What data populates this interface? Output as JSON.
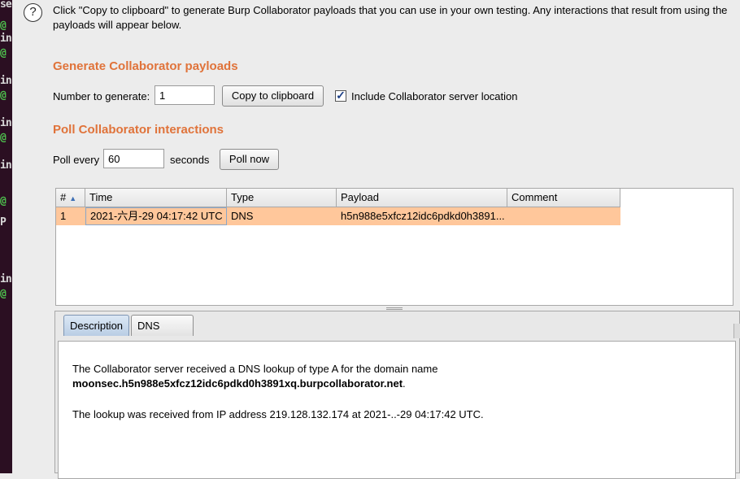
{
  "terminal_fragments": [
    {
      "text": "se",
      "class": ""
    },
    {
      "text": "@",
      "class": "g"
    },
    {
      "text": "in",
      "class": ""
    },
    {
      "text": "@",
      "class": "g"
    },
    {
      "text": "in",
      "class": ""
    },
    {
      "text": "@",
      "class": "g"
    },
    {
      "text": "in",
      "class": ""
    },
    {
      "text": "@",
      "class": "g"
    },
    {
      "text": "in",
      "class": ""
    },
    {
      "text": "@",
      "class": "g"
    },
    {
      "text": "P",
      "class": ""
    },
    {
      "text": "in",
      "class": ""
    },
    {
      "text": "@",
      "class": "g"
    }
  ],
  "intro_text": "Click \"Copy to clipboard\" to generate Burp Collaborator payloads that you can use in your own testing. Any interactions that result from using the payloads will appear below.",
  "generate": {
    "title": "Generate Collaborator payloads",
    "number_label": "Number to generate:",
    "number_value": "1",
    "copy_button": "Copy to clipboard",
    "include_label": "Include Collaborator server location",
    "include_checked": true
  },
  "poll": {
    "title": "Poll Collaborator interactions",
    "every_label": "Poll every",
    "every_value": "60",
    "seconds_label": "seconds",
    "poll_button": "Poll now"
  },
  "table": {
    "columns": [
      "#",
      "Time",
      "Type",
      "Payload",
      "Comment"
    ],
    "rows": [
      {
        "num": "1",
        "time": "2021-六月-29 04:17:42 UTC",
        "type": "DNS",
        "payload": "h5n988e5xfcz12idc6pdkd0h3891...",
        "comment": ""
      }
    ]
  },
  "details": {
    "tabs": [
      "Description",
      "DNS query"
    ],
    "active_tab": "Description",
    "line1": "The Collaborator server received a DNS lookup of type A for the domain name",
    "domain": "moonsec.h5n988e5xfcz12idc6pdkd0h3891xq.burpcollaborator.net",
    "domain_suffix": ".",
    "line3": "The lookup was received from IP address 219.128.132.174 at 2021-..-29 04:17:42 UTC."
  }
}
